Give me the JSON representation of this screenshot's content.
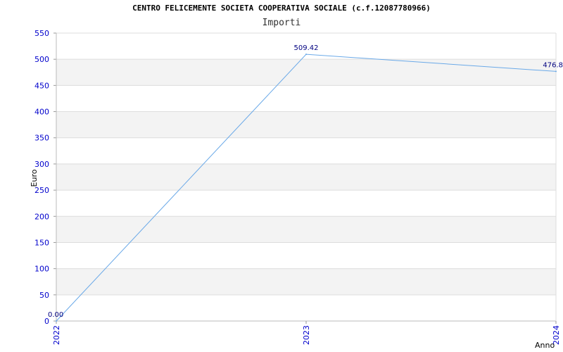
{
  "chart_data": {
    "type": "line",
    "title": "CENTRO FELICEMENTE SOCIETA COOPERATIVA SOCIALE (c.f.12087780966)",
    "subtitle": "Importi",
    "xlabel": "Anno",
    "ylabel": "Euro",
    "categories": [
      "2022",
      "2023",
      "2024"
    ],
    "series": [
      {
        "values": [
          0.0,
          509.42,
          476.8
        ],
        "labels": [
          "0.00",
          "509.42",
          "476.8"
        ]
      }
    ],
    "ylim": [
      0,
      550
    ],
    "yticks": [
      0,
      50,
      100,
      150,
      200,
      250,
      300,
      350,
      400,
      450,
      500,
      550
    ],
    "grid": true,
    "colors": {
      "line": "#6aa9e8",
      "tick_text": "#0000cc",
      "label_text": "#000080",
      "band": "#f3f3f3",
      "gridline": "#dddddd"
    }
  }
}
